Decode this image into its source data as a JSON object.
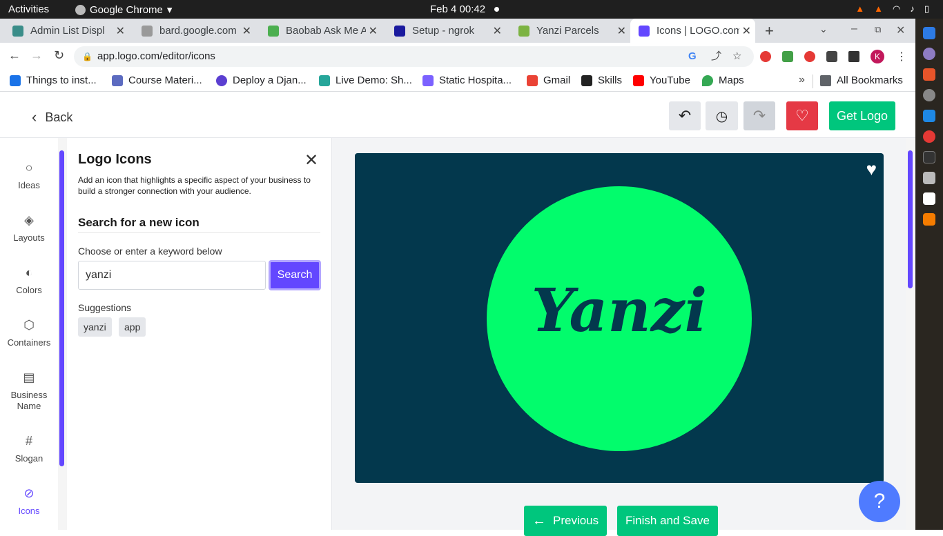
{
  "os": {
    "activities": "Activities",
    "app_name": "Google Chrome",
    "clock": "Feb 4  00:42"
  },
  "tabs": [
    {
      "label": "Admin List Displ",
      "color": "#3a8d89"
    },
    {
      "label": "bard.google.com",
      "color": "#999999"
    },
    {
      "label": "Baobab Ask Me A",
      "color": "#4caf50"
    },
    {
      "label": "Setup - ngrok",
      "color": "#1a1a9e"
    },
    {
      "label": "Yanzi Parcels",
      "color": "#7cb342"
    },
    {
      "label": "Icons | LOGO.com",
      "color": "#6347ff"
    }
  ],
  "omnibox": {
    "url": "app.logo.com/editor/icons"
  },
  "bookmarks": [
    {
      "label": "Things to inst...",
      "color": "#1a73e8"
    },
    {
      "label": "Course Materi...",
      "color": "#5c6bc0"
    },
    {
      "label": "Deploy a Djan...",
      "color": "#5b3fd1"
    },
    {
      "label": "Live Demo: Sh...",
      "color": "#26a69a"
    },
    {
      "label": "Static Hospita...",
      "color": "#7b61ff"
    },
    {
      "label": "Gmail",
      "color": "#ea4335"
    },
    {
      "label": "Skills",
      "color": "#222222"
    },
    {
      "label": "YouTube",
      "color": "#ff0000"
    },
    {
      "label": "Maps",
      "color": "#34a853"
    }
  ],
  "all_bookmarks": "All Bookmarks",
  "header": {
    "back": "Back",
    "get_logo": "Get Logo"
  },
  "sidebar": [
    {
      "label": "Ideas",
      "icon": "bulb-icon",
      "glyph": "💡"
    },
    {
      "label": "Layouts",
      "icon": "layers-icon",
      "glyph": "◈"
    },
    {
      "label": "Colors",
      "icon": "palette-icon",
      "glyph": "🎨"
    },
    {
      "label": "Containers",
      "icon": "container-icon",
      "glyph": "⬡"
    },
    {
      "label": "Business Name",
      "icon": "id-card-icon",
      "glyph": "▤"
    },
    {
      "label": "Slogan",
      "icon": "hash-icon",
      "glyph": "#"
    },
    {
      "label": "Icons",
      "icon": "check-circle-icon",
      "glyph": "✓"
    }
  ],
  "panel": {
    "title": "Logo Icons",
    "description": "Add an icon that highlights a specific aspect of your business to build a stronger connection with your audience.",
    "subtitle": "Search for a new icon",
    "label": "Choose or enter a keyword below",
    "input_value": "yanzi",
    "search_button": "Search",
    "suggestions_label": "Suggestions",
    "suggestions": [
      "yanzi",
      "app"
    ]
  },
  "canvas": {
    "logo_text": "Yanzi",
    "bg_color": "#03384d",
    "circle_color": "#02fc6c",
    "previous": "Previous",
    "finish": "Finish and Save",
    "help": "?"
  }
}
